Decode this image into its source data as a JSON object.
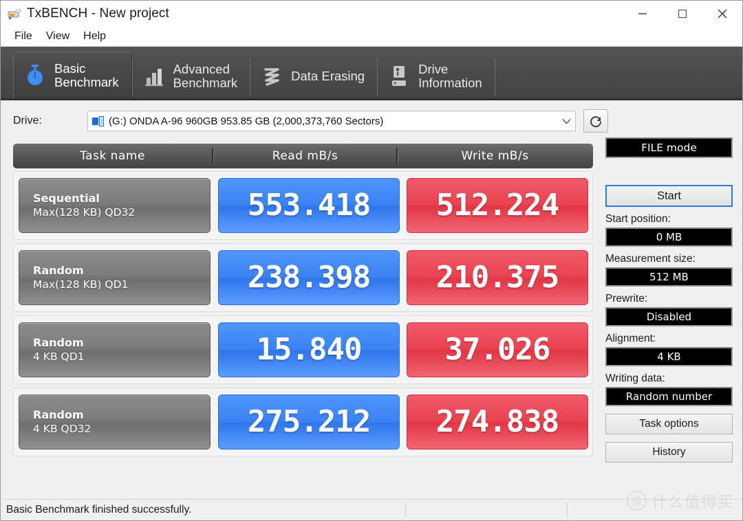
{
  "window": {
    "title": "TxBENCH - New project",
    "icon": "app-icon",
    "controls": [
      {
        "name": "minimize",
        "glyph": "—"
      },
      {
        "name": "maximize",
        "glyph": "☐"
      },
      {
        "name": "close",
        "glyph": "✕"
      }
    ]
  },
  "menu": {
    "items": [
      {
        "label": "File"
      },
      {
        "label": "View"
      },
      {
        "label": "Help"
      }
    ]
  },
  "tabs": [
    {
      "line1": "Basic",
      "line2": "Benchmark",
      "icon": "stopwatch-icon",
      "active": true
    },
    {
      "line1": "Advanced",
      "line2": "Benchmark",
      "icon": "bar-chart-icon",
      "active": false
    },
    {
      "line1": "Data Erasing",
      "line2": "",
      "icon": "shredder-icon",
      "active": false
    },
    {
      "line1": "Drive",
      "line2": "Information",
      "icon": "drive-icon",
      "active": false
    }
  ],
  "drive": {
    "label": "Drive:",
    "selected": "(G:) ONDA A-96 960GB  953.85 GB (2,000,373,760 Sectors)",
    "dropdown_icon": "chevron-down-icon",
    "refresh_icon": "refresh-icon"
  },
  "table": {
    "headers": {
      "task": "Task name",
      "read": "Read mB/s",
      "write": "Write mB/s"
    },
    "rows": [
      {
        "line1": "Sequential",
        "line2": "Max(128 KB) QD32",
        "read": "553.418",
        "write": "512.224"
      },
      {
        "line1": "Random",
        "line2": "Max(128 KB) QD1",
        "read": "238.398",
        "write": "210.375"
      },
      {
        "line1": "Random",
        "line2": "4 KB QD1",
        "read": "15.840",
        "write": "37.026"
      },
      {
        "line1": "Random",
        "line2": "4 KB QD32",
        "read": "275.212",
        "write": "274.838"
      }
    ]
  },
  "sidebar": {
    "mode_button": "FILE mode",
    "start_button": "Start",
    "fields": [
      {
        "label": "Start position:",
        "value": "0 MB"
      },
      {
        "label": "Measurement size:",
        "value": "512 MB"
      },
      {
        "label": "Prewrite:",
        "value": "Disabled"
      },
      {
        "label": "Alignment:",
        "value": "4 KB"
      },
      {
        "label": "Writing data:",
        "value": "Random number"
      }
    ],
    "buttons": [
      {
        "label": "Task options"
      },
      {
        "label": "History"
      }
    ]
  },
  "statusbar": {
    "message": "Basic Benchmark finished successfully.",
    "pane2": "",
    "pane3": ""
  },
  "watermark": {
    "badge": "值",
    "text": "什么值得买"
  },
  "colors": {
    "read_accent": "#3b83f2",
    "write_accent": "#e8434f",
    "tabstrip": "#4a4a4a",
    "focus_blue": "#2a7fd4"
  },
  "chart_data": {
    "type": "table",
    "title": "Basic Benchmark results",
    "categories": [
      "Sequential Max(128 KB) QD32",
      "Random Max(128 KB) QD1",
      "Random 4 KB QD1",
      "Random 4 KB QD32"
    ],
    "series": [
      {
        "name": "Read mB/s",
        "values": [
          553.418,
          238.398,
          15.84,
          275.212
        ]
      },
      {
        "name": "Write mB/s",
        "values": [
          512.224,
          210.375,
          37.026,
          274.838
        ]
      }
    ],
    "xlabel": "Task name",
    "ylabel": "mB/s"
  }
}
